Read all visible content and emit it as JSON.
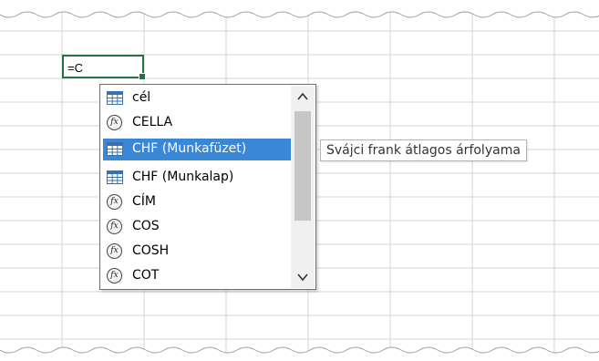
{
  "active_cell": {
    "content": "=C"
  },
  "autocomplete": {
    "items": [
      {
        "label": "cél",
        "icon": "table-icon"
      },
      {
        "label": "CELLA",
        "icon": "function-icon"
      },
      {
        "label": "CHF (Munkafüzet)",
        "icon": "table-icon",
        "selected": true
      },
      {
        "label": "CHF (Munkalap)",
        "icon": "table-icon"
      },
      {
        "label": "CÍM",
        "icon": "function-icon"
      },
      {
        "label": "COS",
        "icon": "function-icon"
      },
      {
        "label": "COSH",
        "icon": "function-icon"
      },
      {
        "label": "COT",
        "icon": "function-icon"
      }
    ],
    "scroll_up_glyph": "⌃",
    "scroll_down_glyph": "⌄"
  },
  "tooltip": {
    "text": "Svájci frank átlagos árfolyama"
  },
  "colors": {
    "selection": "#3a87d6",
    "cell_border": "#217346",
    "grid": "#d4d4d4"
  }
}
